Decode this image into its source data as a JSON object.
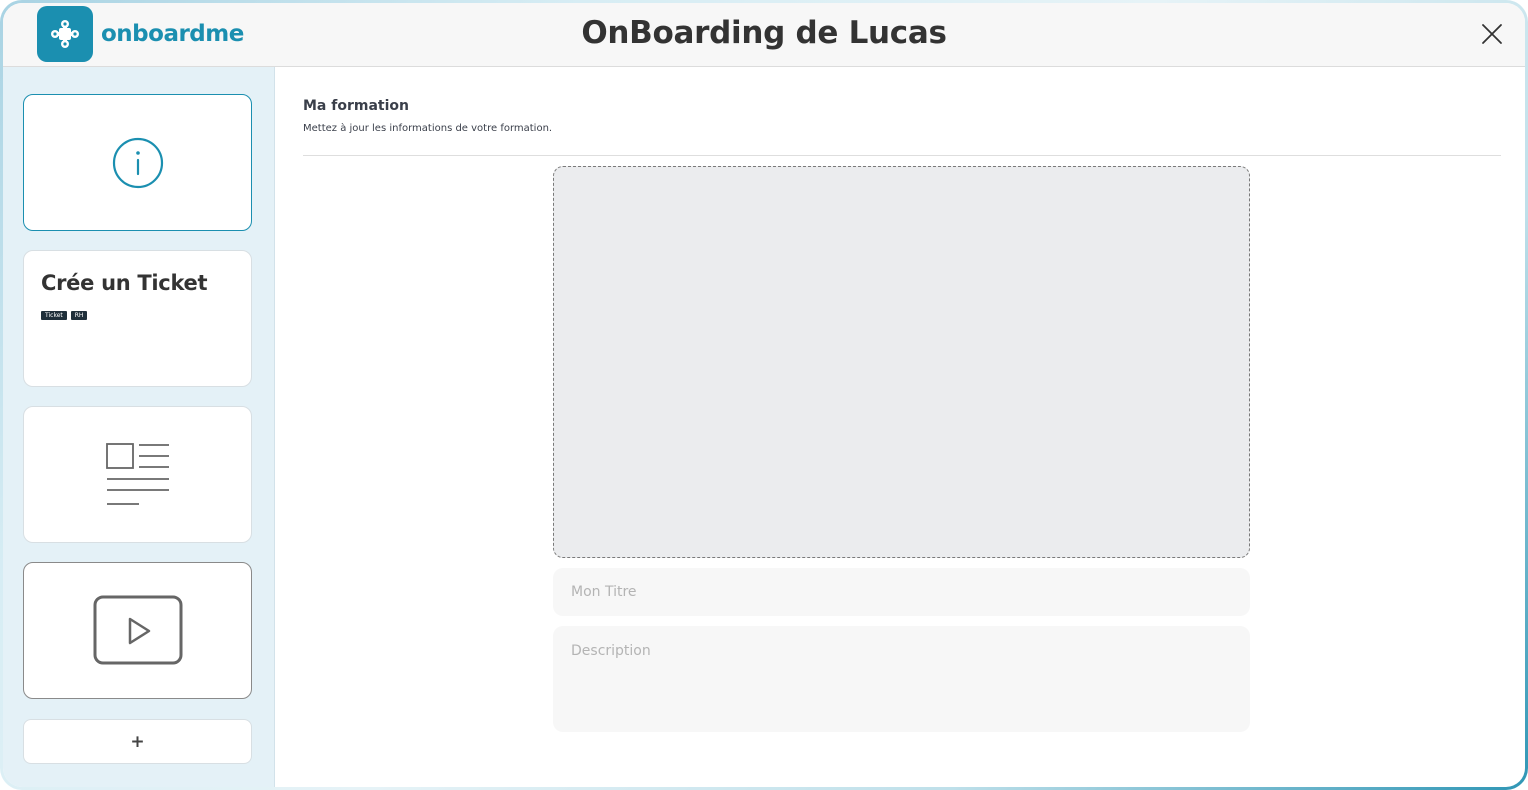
{
  "app": {
    "logo_text": "onboardme",
    "title": "OnBoarding de Lucas",
    "accent_color": "#1b8fb0"
  },
  "sidebar": {
    "cards": [
      {
        "type": "info",
        "icon": "info-circle-icon"
      },
      {
        "type": "ticket",
        "title": "Crée un Ticket",
        "tags": [
          "Ticket",
          "RH"
        ]
      },
      {
        "type": "article",
        "icon": "article-layout-icon"
      },
      {
        "type": "video",
        "icon": "play-icon"
      }
    ],
    "add_label": "+"
  },
  "main": {
    "section_title": "Ma formation",
    "section_subtitle": "Mettez à jour les informations de votre formation.",
    "title_placeholder": "Mon Titre",
    "description_placeholder": "Description"
  }
}
